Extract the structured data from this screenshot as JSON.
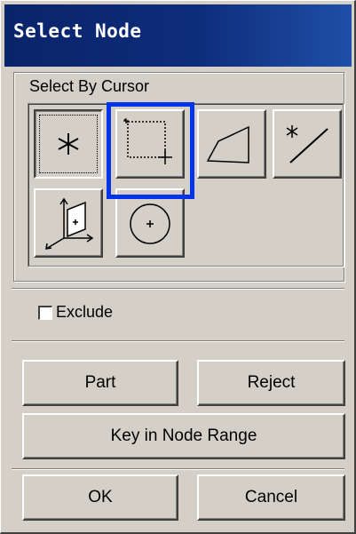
{
  "window": {
    "title": "Select Node",
    "accent": "#0a246a"
  },
  "select_by_cursor": {
    "label": "Select By Cursor",
    "tools": [
      {
        "name": "single-node-tool",
        "icon": "asterisk-icon",
        "active": true
      },
      {
        "name": "box-select-tool",
        "icon": "box-select-icon",
        "highlighted": true
      },
      {
        "name": "polygon-select-tool",
        "icon": "polygon-icon"
      },
      {
        "name": "line-select-tool",
        "icon": "line-select-icon"
      },
      {
        "name": "plane-select-tool",
        "icon": "plane-axes-icon"
      },
      {
        "name": "circle-select-tool",
        "icon": "circle-select-icon"
      }
    ],
    "highlight_color": "#0033ee"
  },
  "exclude": {
    "label": "Exclude",
    "checked": false
  },
  "buttons": {
    "part": "Part",
    "reject": "Reject",
    "key_in_node_range": "Key in Node Range",
    "ok": "OK",
    "cancel": "Cancel"
  }
}
